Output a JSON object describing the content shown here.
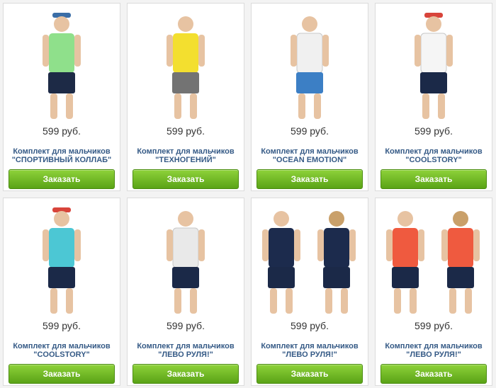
{
  "products": [
    {
      "price": "599 руб.",
      "title1": "Комплект для мальчиков",
      "title2": "\"СПОРТИВНЫЙ КОЛЛАБ\"",
      "button": "Заказать",
      "photo_icon": "boy-tshirt-shorts-icon",
      "colors": {
        "shirt": "#8fe08b",
        "pants": "#1d2a46",
        "hat": "#3b6ea7"
      }
    },
    {
      "price": "599 руб.",
      "title1": "Комплект для мальчиков",
      "title2": "\"ТЕХНОГЕНИЙ\"",
      "button": "Заказать",
      "photo_icon": "boy-tshirt-shorts-icon",
      "colors": {
        "shirt": "#f3df2f",
        "pants": "#737373",
        "hat": ""
      }
    },
    {
      "price": "599 руб.",
      "title1": "Комплект для мальчиков",
      "title2": "\"OCEAN EMOTION\"",
      "button": "Заказать",
      "photo_icon": "boy-tshirt-shorts-icon",
      "colors": {
        "shirt": "#f0f0f0",
        "pants": "#3c7fc5",
        "hat": ""
      }
    },
    {
      "price": "599 руб.",
      "title1": "Комплект для мальчиков",
      "title2": "\"COOLSTORY\"",
      "button": "Заказать",
      "photo_icon": "boy-tshirt-shorts-icon",
      "colors": {
        "shirt": "#f5f5f5",
        "pants": "#1b2948",
        "hat": "#d8443a"
      }
    },
    {
      "price": "599 руб.",
      "title1": "Комплект для мальчиков",
      "title2": "\"COOLSTORY\"",
      "button": "Заказать",
      "photo_icon": "boy-tshirt-shorts-icon",
      "colors": {
        "shirt": "#4cc7d4",
        "pants": "#1b2948",
        "hat": "#d8443a"
      }
    },
    {
      "price": "599 руб.",
      "title1": "Комплект для мальчиков",
      "title2": "\"ЛЕВО РУЛЯ!\"",
      "button": "Заказать",
      "photo_icon": "boy-tshirt-shorts-icon",
      "colors": {
        "shirt": "#e9e9e9",
        "pants": "#1b2948",
        "hat": ""
      }
    },
    {
      "price": "599 руб.",
      "title1": "Комплект для мальчиков",
      "title2": "\"ЛЕВО РУЛЯ!\"",
      "button": "Заказать",
      "photo_icon": "two-boys-front-back-icon",
      "colors": {
        "shirt": "#1c2b4d",
        "pants": "#1b2948",
        "hat": ""
      }
    },
    {
      "price": "599 руб.",
      "title1": "Комплект для мальчиков",
      "title2": "\"ЛЕВО РУЛЯ!\"",
      "button": "Заказать",
      "photo_icon": "two-boys-front-back-icon",
      "colors": {
        "shirt": "#ef5a3f",
        "pants": "#1b2948",
        "hat": ""
      }
    }
  ]
}
